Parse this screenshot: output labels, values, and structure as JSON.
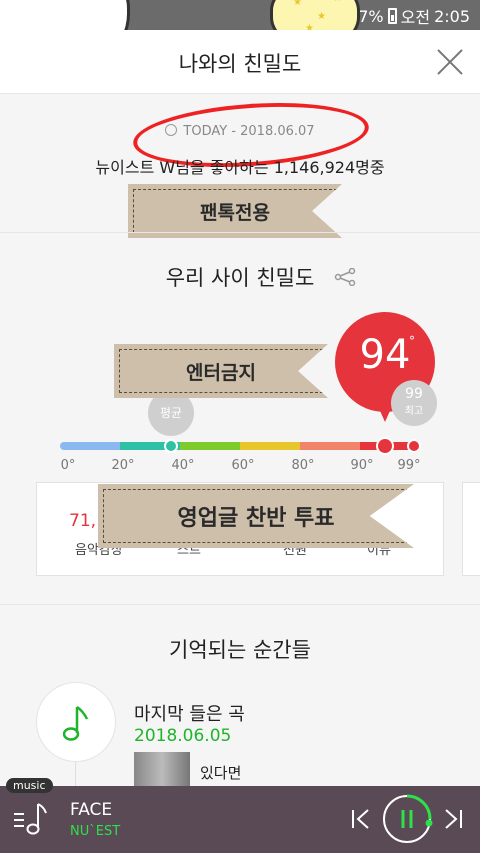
{
  "status": {
    "battery": "47%",
    "period": "오전",
    "time": "2:05"
  },
  "header": {
    "title": "나와의 친밀도"
  },
  "today": {
    "text": "TODAY - 2018.06.07"
  },
  "fans_text": "뉴이스트 W님을 좋아하는 1,146,924명중",
  "tags": {
    "fantalk": "팬톡전용",
    "no_entertain": "엔터금지",
    "vote": "영업글 찬반 투표"
  },
  "intimacy": {
    "title": "우리 사이 친밀도",
    "score": "94",
    "degree_symbol": "°",
    "average_label": "평균",
    "max_value": "99",
    "max_label": "최고",
    "ticks": [
      "0°",
      "20°",
      "40°",
      "60°",
      "80°",
      "90°",
      "99°"
    ]
  },
  "card": {
    "value": "71,",
    "labels": [
      "음악감상",
      "스트",
      "전원",
      "이뷰"
    ]
  },
  "moments": {
    "title": "기억되는 순간들",
    "item_title": "마지막 들은 곡",
    "item_date": "2018.06.05",
    "song": "있다면"
  },
  "player": {
    "badge": "music",
    "title": "FACE",
    "artist": "NU`EST"
  },
  "colors": {
    "accent_red": "#e5343b",
    "accent_green": "#1fb52a",
    "player_bg": "#5a4a55"
  }
}
